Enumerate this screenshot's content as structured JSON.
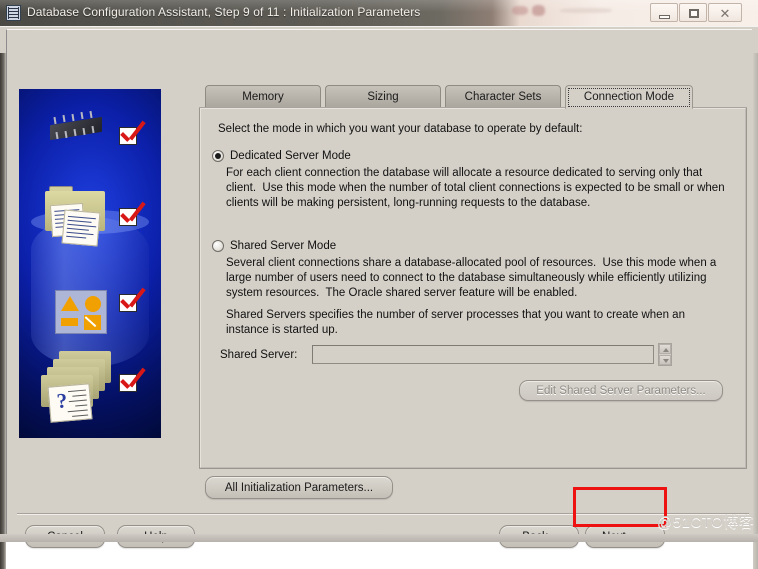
{
  "window": {
    "title": "Database Configuration Assistant, Step 9 of 11 : Initialization Parameters",
    "app_icon": "database-icon",
    "controls": {
      "minimize": "minimize-button",
      "maximize": "maximize-button",
      "close_glyph": "✕"
    }
  },
  "tabs": [
    {
      "label": "Memory",
      "selected": false
    },
    {
      "label": "Sizing",
      "selected": false
    },
    {
      "label": "Character Sets",
      "selected": false
    },
    {
      "label": "Connection Mode",
      "selected": true
    }
  ],
  "content": {
    "intro": "Select the mode in which you want your database to operate by default:",
    "dedicated": {
      "label": "Dedicated Server Mode",
      "selected": true,
      "description": "For each client connection the database will allocate a resource dedicated to serving only that client.  Use this mode when the number of total client connections is expected to be small or when clients will be making persistent, long-running requests to the database."
    },
    "shared": {
      "label": "Shared Server Mode",
      "selected": false,
      "description": "Several client connections share a database-allocated pool of resources.  Use this mode when a large number of users need to connect to the database simultaneously while efficiently utilizing system resources.  The Oracle shared server feature will be enabled.",
      "note": "Shared Servers specifies the number of server processes that you want to create when an instance is started up."
    },
    "shared_server_field": {
      "label": "Shared Server:",
      "value": "",
      "placeholder": ""
    },
    "edit_shared_button": {
      "label": "Edit Shared Server Parameters...",
      "enabled": false
    }
  },
  "footer": {
    "all_params_button": "All Initialization Parameters...",
    "cancel_button": "Cancel",
    "help_button": "Help",
    "back_button": "Back",
    "back_chevron": "«",
    "next_button": "Next",
    "next_chevron": "»"
  },
  "annotation": {
    "highlight_color": "#ee1111",
    "highlight_target": "next-button"
  },
  "watermark": "@51CTO博客",
  "sidebar_art": {
    "name": "oracle-dbca-illustration",
    "background_color": "#041060",
    "check_color": "#d81717",
    "check_count": 4
  }
}
